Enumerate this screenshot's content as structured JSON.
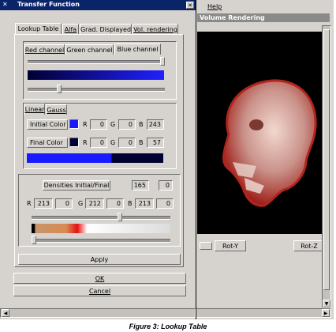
{
  "dialog": {
    "title": "Transfer Function",
    "tabs": [
      "Lookup Table",
      "Alfa",
      "Grad. Displayed",
      "Vol. rendering"
    ],
    "channel_tabs": [
      "Red channel",
      "Green channel",
      "Blue channel"
    ],
    "curve_tabs": [
      "Linear",
      "Gauss"
    ],
    "initial_color": {
      "label": "Initial Color",
      "swatch": "#1a1aff",
      "r_label": "R",
      "r": "0",
      "g_label": "G",
      "g": "0",
      "b_label": "B",
      "b": "243"
    },
    "final_color": {
      "label": "Final Color",
      "swatch": "#000039",
      "r_label": "R",
      "r": "0",
      "g_label": "G",
      "g": "0",
      "b_label": "B",
      "b": "57"
    },
    "densities": {
      "label": "Densities Initial/Final",
      "initial": "165",
      "final": "0"
    },
    "rgb_row": {
      "r_label": "R",
      "r1": "213",
      "r2": "0",
      "g_label": "G",
      "g1": "212",
      "g2": "0",
      "b_label": "B",
      "b1": "213",
      "b2": "0"
    },
    "apply_label": "Apply",
    "ok_label": "OK",
    "cancel_label": "Cancel"
  },
  "background_app": {
    "menu_help": "Help",
    "window_title": "Volume Rendering",
    "rot_y_label": "Rot-Y",
    "rot_z_label": "Rot-Z"
  },
  "caption": "Figure 3: Lookup Table",
  "colors": {
    "title_bar": "#0a246a",
    "face": "#d6d3ce",
    "blue": "#1a1aff"
  }
}
